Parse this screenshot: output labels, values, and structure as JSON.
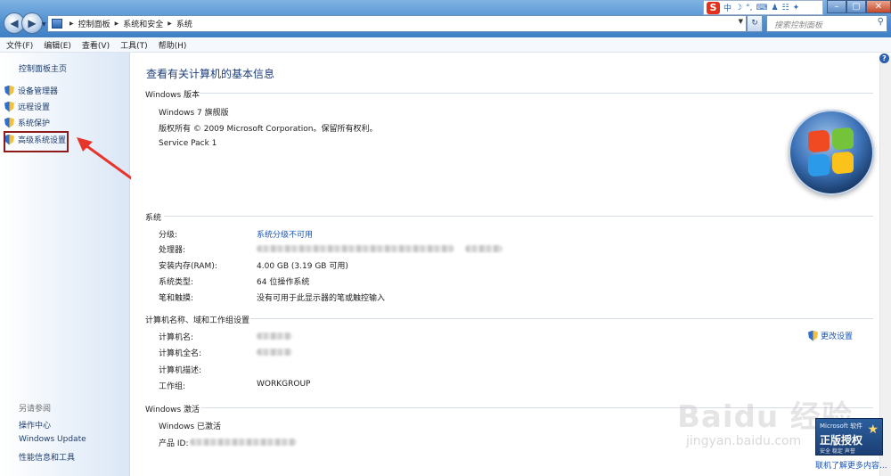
{
  "address": {
    "crumbs": [
      "控制面板",
      "系统和安全",
      "系统"
    ],
    "search_placeholder": "搜索控制面板"
  },
  "menu": [
    "文件(F)",
    "编辑(E)",
    "查看(V)",
    "工具(T)",
    "帮助(H)"
  ],
  "ime": {
    "logo": "S",
    "items": [
      "中",
      "☽",
      "°,",
      "⌨",
      "♟",
      "☷",
      "✦"
    ]
  },
  "left": {
    "home": "控制面板主页",
    "items": [
      "设备管理器",
      "远程设置",
      "系统保护",
      "高级系统设置"
    ],
    "see_also": "另请参阅",
    "links": [
      "操作中心",
      "Windows Update",
      "性能信息和工具"
    ]
  },
  "main": {
    "title": "查看有关计算机的基本信息",
    "edition_header": "Windows 版本",
    "edition": "Windows 7 旗舰版",
    "copyright": "版权所有 © 2009 Microsoft Corporation。保留所有权利。",
    "service_pack": "Service Pack 1",
    "system_header": "系统",
    "rating_label": "分级:",
    "rating_value": "系统分级不可用",
    "processor_label": "处理器:",
    "ram_label": "安装内存(RAM):",
    "ram_value": "4.00 GB (3.19 GB 可用)",
    "type_label": "系统类型:",
    "type_value": "64 位操作系统",
    "pen_label": "笔和触摸:",
    "pen_value": "没有可用于此显示器的笔或触控输入",
    "computer_header": "计算机名称、域和工作组设置",
    "name_label": "计算机名:",
    "fullname_label": "计算机全名:",
    "desc_label": "计算机描述:",
    "workgroup_label": "工作组:",
    "workgroup_value": "WORKGROUP",
    "change_settings": "更改设置",
    "activation_header": "Windows 激活",
    "activated": "Windows 已激活",
    "product_id_label": "产品 ID:"
  },
  "genuine": {
    "small": "Microsoft 软件",
    "big": "正版授权",
    "sub": "安全 稳定 声誉"
  },
  "learn_more": "联机了解更多内容...",
  "watermark": {
    "main": "Baidu 经验",
    "sub": "jingyan.baidu.com"
  },
  "colors": {
    "link": "#1a55b8",
    "title": "#1e3e7a",
    "highlight_box": "#8e1a1a",
    "arrow": "#e8352b"
  }
}
